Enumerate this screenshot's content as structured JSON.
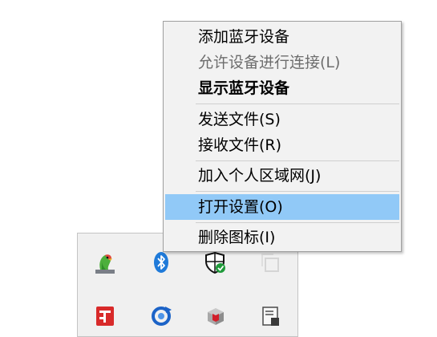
{
  "context_menu": {
    "items": [
      {
        "label": "添加蓝牙设备"
      },
      {
        "label": "允许设备进行连接(L)"
      },
      {
        "label": "显示蓝牙设备"
      },
      {
        "label": "发送文件(S)"
      },
      {
        "label": "接收文件(R)"
      },
      {
        "label": "加入个人区域网(J)"
      },
      {
        "label": "打开设置(O)"
      },
      {
        "label": "删除图标(I)"
      }
    ],
    "highlight_color": "#91c9f7",
    "disabled_color": "#6d6d6d"
  },
  "tray": {
    "icons": [
      "parrot-app-icon",
      "bluetooth-icon",
      "windows-security-shield-icon",
      "window-outline-icon",
      "red-app-icon",
      "blue-sync-icon",
      "red-cube-icon",
      "document-app-icon"
    ]
  }
}
